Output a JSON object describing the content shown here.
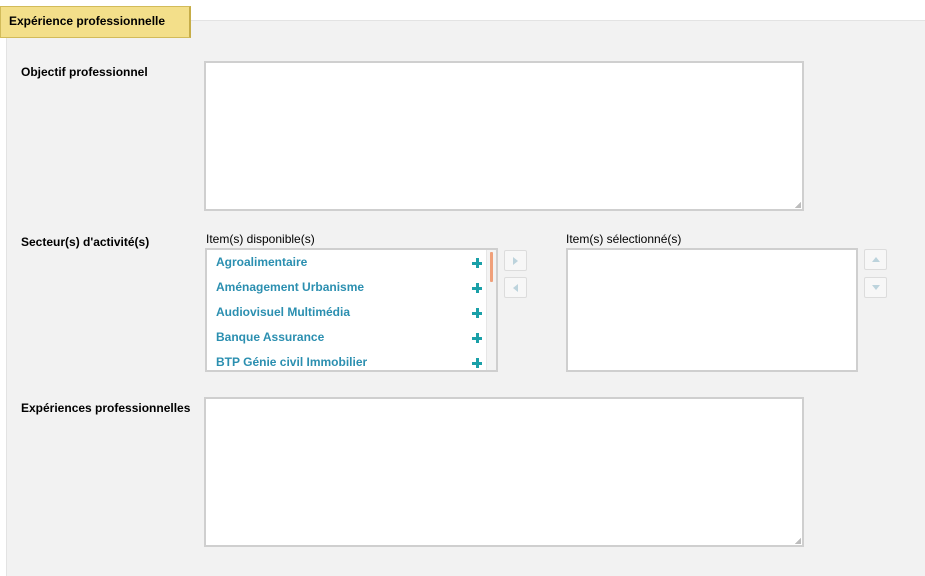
{
  "section": {
    "tab_label": "Expérience professionnelle"
  },
  "form": {
    "objective": {
      "label": "Objectif professionnel",
      "value": ""
    },
    "sectors": {
      "label": "Secteur(s) d'activité(s)",
      "available_title": "Item(s) disponible(s)",
      "selected_title": "Item(s) sélectionné(s)",
      "available_items": [
        "Agroalimentaire",
        "Aménagement Urbanisme",
        "Audiovisuel Multimédia",
        "Banque Assurance",
        "BTP Génie civil Immobilier"
      ],
      "selected_items": []
    },
    "experiences": {
      "label": "Expériences professionnelles",
      "value": ""
    }
  },
  "colors": {
    "tab_background": "#f3df8a",
    "item_text": "#2b8fb0",
    "plus_icon": "#1aa0a8",
    "scroll_thumb": "#f0a07a",
    "panel_background": "#f2f2f2"
  },
  "icons": {
    "add": "plus-icon",
    "move_right": "arrow-right-icon",
    "move_left": "arrow-left-icon",
    "move_up": "arrow-up-icon",
    "move_down": "arrow-down-icon"
  }
}
